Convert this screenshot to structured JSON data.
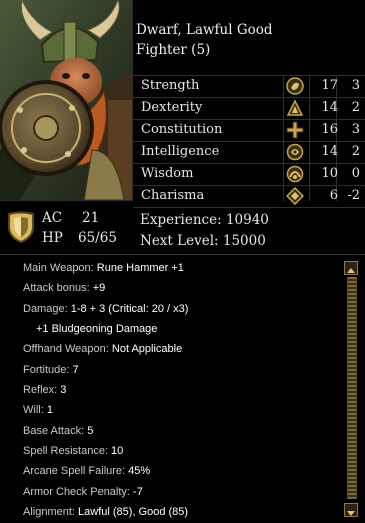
{
  "header": {
    "race_alignment": "Dwarf, Lawful Good",
    "class_level": "Fighter (5)"
  },
  "attributes": [
    {
      "name": "Strength",
      "score": "17",
      "mod": "3",
      "icon": "strength-icon"
    },
    {
      "name": "Dexterity",
      "score": "14",
      "mod": "2",
      "icon": "dexterity-icon"
    },
    {
      "name": "Constitution",
      "score": "16",
      "mod": "3",
      "icon": "constitution-icon"
    },
    {
      "name": "Intelligence",
      "score": "14",
      "mod": "2",
      "icon": "intelligence-icon"
    },
    {
      "name": "Wisdom",
      "score": "10",
      "mod": "0",
      "icon": "wisdom-icon"
    },
    {
      "name": "Charisma",
      "score": "6",
      "mod": "-2",
      "icon": "charisma-icon"
    }
  ],
  "defense": {
    "ac_label": "AC",
    "ac_value": "21",
    "hp_label": "HP",
    "hp_value": "65/65"
  },
  "progress": {
    "xp_label": "Experience:",
    "xp_value": "10940",
    "next_label": "Next Level:",
    "next_value": "15000"
  },
  "details": [
    {
      "label": "Main Weapon: ",
      "value": "Rune Hammer +1"
    },
    {
      "label": "Attack bonus: ",
      "value": "+9"
    },
    {
      "label": "Damage: ",
      "value": "1-8 + 3 (Critical: 20 / x3)"
    },
    {
      "label": "",
      "value": "+1 Bludgeoning Damage"
    },
    {
      "label": "Offhand Weapon: ",
      "value": "Not Applicable"
    },
    {
      "label": "Fortitude: ",
      "value": "7"
    },
    {
      "label": "Reflex: ",
      "value": "3"
    },
    {
      "label": "Will: ",
      "value": "1"
    },
    {
      "label": "Base Attack: ",
      "value": "5"
    },
    {
      "label": "Spell Resistance: ",
      "value": "10"
    },
    {
      "label": "Arcane Spell Failure: ",
      "value": "45%"
    },
    {
      "label": "Armor Check Penalty: ",
      "value": "-7"
    },
    {
      "label": "Alignment: ",
      "value": "Lawful (85), Good (85)"
    }
  ],
  "colors": {
    "background": "#000000",
    "gold_accent": "#c9a64a",
    "text": "#e6e6e6"
  }
}
